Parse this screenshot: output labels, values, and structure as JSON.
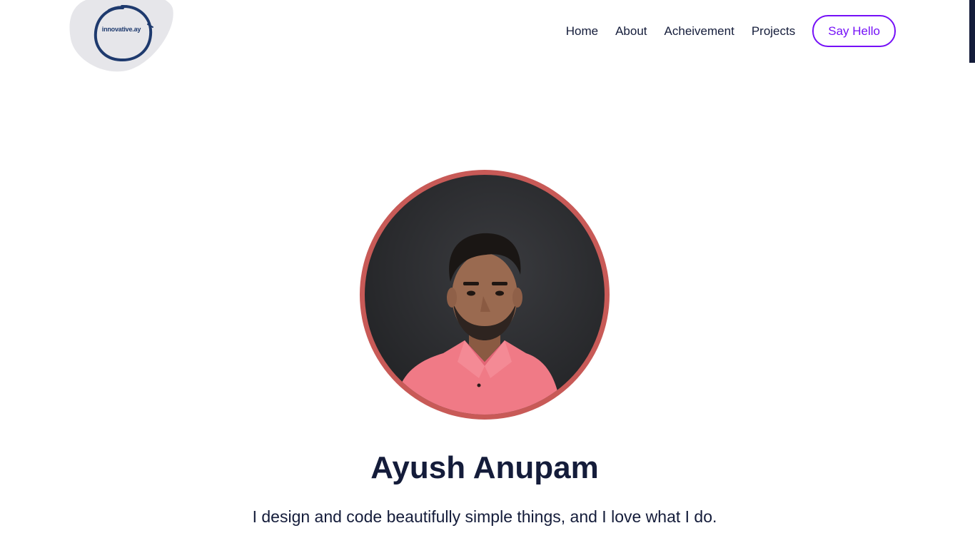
{
  "logo": {
    "text": "innovative.ay"
  },
  "nav": {
    "items": [
      {
        "label": "Home"
      },
      {
        "label": "About"
      },
      {
        "label": "Acheivement"
      },
      {
        "label": "Projects"
      }
    ],
    "cta_label": "Say Hello"
  },
  "hero": {
    "name": "Ayush Anupam",
    "tagline": "I design and code beautifully simple things, and I love what I do."
  },
  "colors": {
    "text": "#141c3a",
    "accent": "#7510f7",
    "avatar_ring": "#c85a57",
    "logo_blob": "#e6e6ea",
    "logo_ink": "#1e3a6e"
  }
}
